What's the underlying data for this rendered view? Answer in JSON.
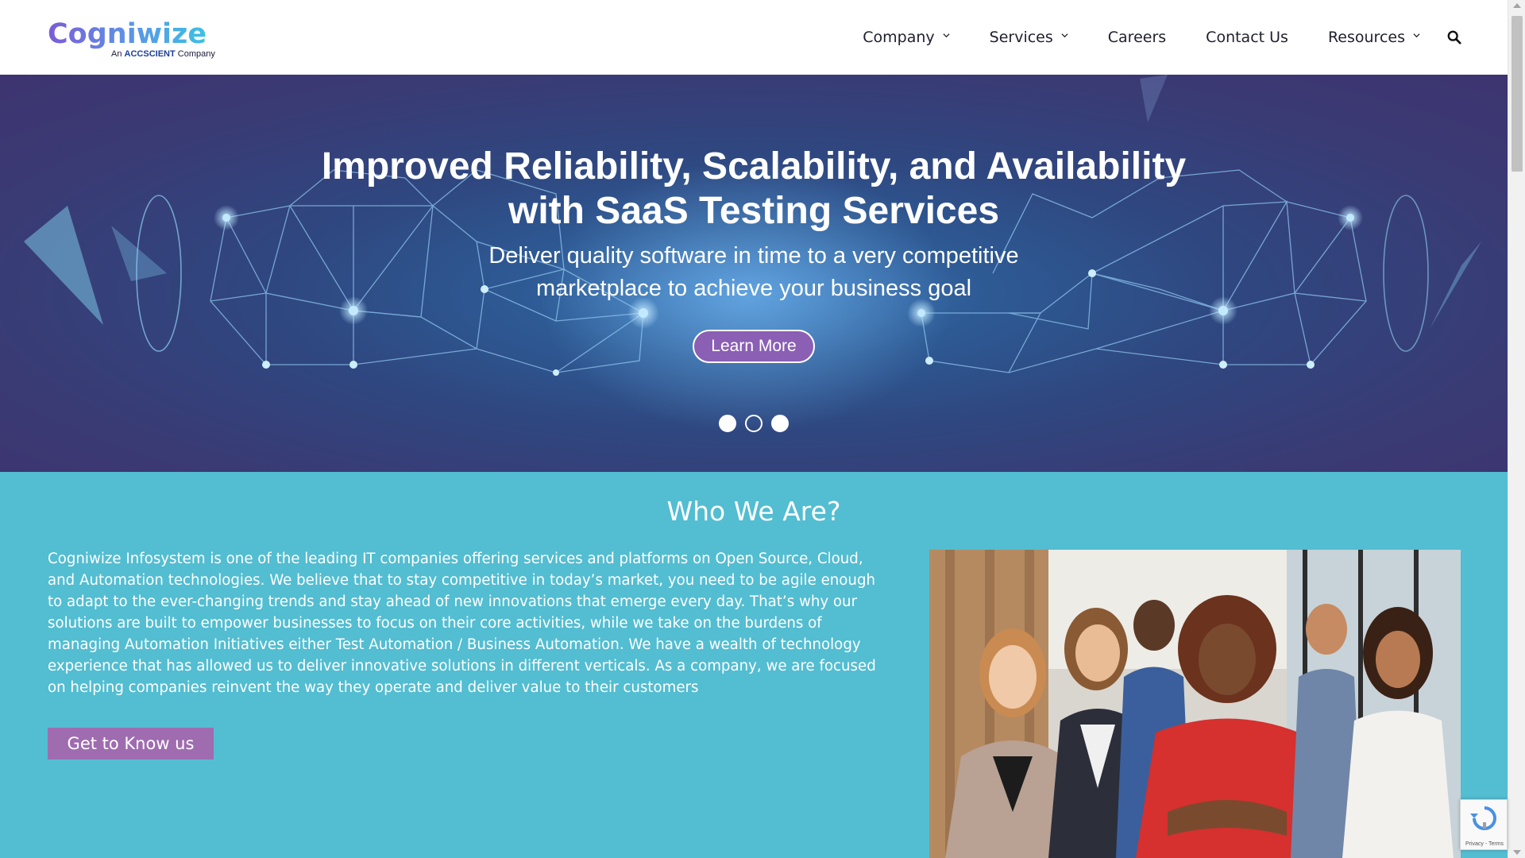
{
  "header": {
    "logo_text": "Cogniwize",
    "logo_sub_prefix": "An",
    "logo_sub_brand": "ACCSCIENT",
    "logo_sub_suffix": "Company",
    "nav": [
      {
        "label": "Company",
        "dropdown": true
      },
      {
        "label": "Services",
        "dropdown": true
      },
      {
        "label": "Careers",
        "dropdown": false
      },
      {
        "label": "Contact Us",
        "dropdown": false
      },
      {
        "label": "Resources",
        "dropdown": true
      }
    ],
    "search_icon": "search-icon"
  },
  "hero": {
    "title_line1": "Improved Reliability, Scalability, and Availability",
    "title_line2": "with SaaS Testing Services",
    "subtitle_line1": "Deliver quality software in time to a very competitive",
    "subtitle_line2": "marketplace to achieve your business goal",
    "cta_label": "Learn More",
    "slides": [
      {
        "active": false
      },
      {
        "active": true
      },
      {
        "active": false
      }
    ]
  },
  "about": {
    "title": "Who We Are?",
    "body": "Cogniwize Infosystem is one of the leading IT companies offering services and platforms on Open Source, Cloud, and Automation technologies. We believe that to stay competitive in today’s market, you need to be agile enough to adapt to the ever-changing trends and stay ahead of new innovations that emerge every day. That’s why our solutions are built to empower businesses to focus on their core activities, while we take on the burdens of managing Automation Initiatives either Test Automation / Business Automation. We have a wealth of technology experience that has allowed us to deliver innovative solutions in different verticals. As a company, we are focused on helping companies reinvent the way they operate and deliver value to their customers",
    "cta_label": "Get to Know us"
  },
  "recaptcha": {
    "terms_text": "Privacy - Terms"
  },
  "colors": {
    "hero_bg": "#2f4780",
    "about_bg": "#53bdd1",
    "button_purple": "#9f6cb0",
    "nav_text": "#1f1f2e"
  }
}
